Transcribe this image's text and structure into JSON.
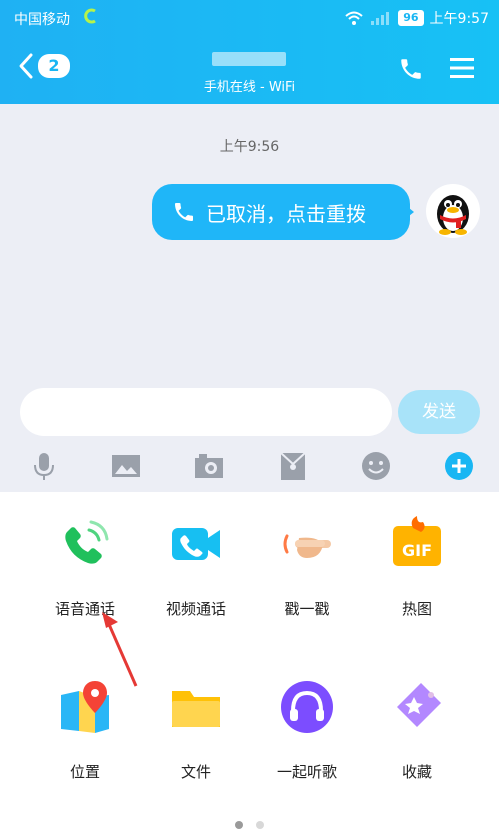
{
  "status_bar": {
    "carrier": "中国移动",
    "battery": "96",
    "time": "上午9:57"
  },
  "header": {
    "unread_count": "2",
    "subtitle": "手机在线 - WiFi"
  },
  "chat": {
    "timestamp": "上午9:56",
    "message": "已取消，点击重拨"
  },
  "input": {
    "send_label": "发送"
  },
  "toolbar": [
    "mic-icon",
    "image-icon",
    "camera-icon",
    "red-packet-icon",
    "emoji-icon",
    "plus-icon"
  ],
  "panel": {
    "items": [
      {
        "label": "语音通话",
        "icon": "voice-call-icon"
      },
      {
        "label": "视频通话",
        "icon": "video-call-icon"
      },
      {
        "label": "戳一戳",
        "icon": "poke-icon"
      },
      {
        "label": "热图",
        "icon": "gif-icon"
      },
      {
        "label": "位置",
        "icon": "location-icon"
      },
      {
        "label": "文件",
        "icon": "folder-icon"
      },
      {
        "label": "一起听歌",
        "icon": "headphones-icon"
      },
      {
        "label": "收藏",
        "icon": "favorites-icon"
      }
    ],
    "page_count": 2,
    "active_page": 1
  },
  "colors": {
    "accent": "#19b6f3",
    "chat_bg": "#eceef5",
    "send_disabled": "#a8e3f9"
  }
}
